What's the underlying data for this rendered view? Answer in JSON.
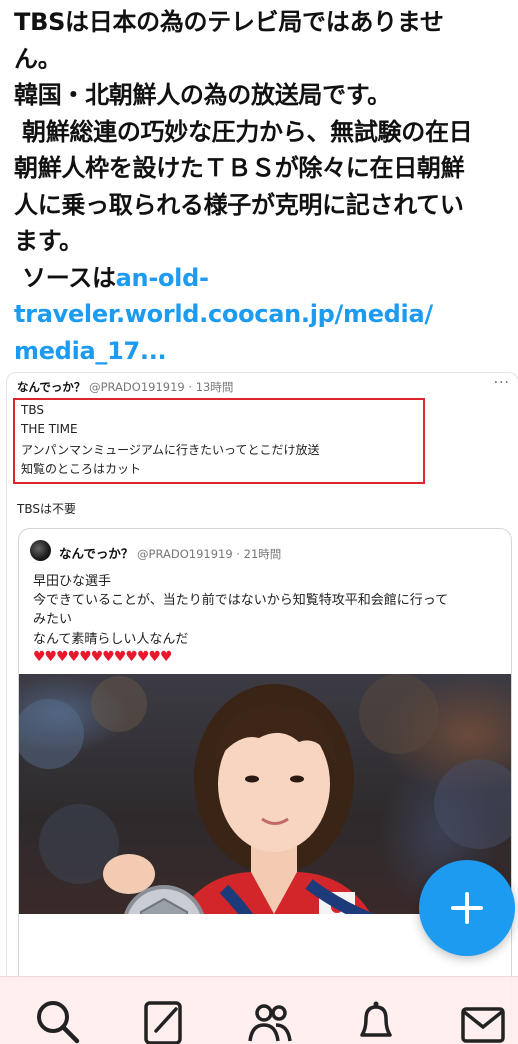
{
  "tweet": {
    "lines": [
      "TBSは日本の為のテレビ局ではありませ",
      "ん。",
      "韓国・北朝鮮人の為の放送局です。",
      " 朝鮮総連の巧妙な圧力から、無試験の在日",
      "朝鮮人枠を設けたＴＢＳが除々に在日朝鮮",
      "人に乗っ取られる様子が克明に記されてい",
      "ます。"
    ],
    "source_label": " ソースは",
    "link_lines": [
      "an-old-",
      "traveler.world.coocan.jp/media/",
      "media_17..."
    ]
  },
  "screenshot": {
    "header": {
      "name": "なんでっか？",
      "handle_time": " @PRADO191919 · 13時間"
    },
    "more_icon": "···",
    "highlighted_lines": [
      "TBS",
      "THE TIME",
      "アンパンマンミュージアムに行きたいってとこだけ放送",
      "知覧のところはカット"
    ],
    "comment": "TBSは不要",
    "quote": {
      "name": "なんでっか？",
      "handle_time": " @PRADO191919 · 21時間",
      "lines": [
        "早田ひな選手",
        "今できていることが、当たり前ではないから知覧特攻平和会館に行って",
        "みたい",
        "なんて素晴らしい人なんだ"
      ],
      "hearts": "♥♥♥♥♥♥♥♥♥♥♥♥"
    }
  },
  "fab_icon": "plus-icon",
  "tabbar": {
    "icons": [
      "search-icon",
      "compose-icon",
      "people-icon",
      "bell-icon",
      "mail-icon"
    ]
  },
  "colors": {
    "link": "#1d9bf0",
    "highlight_border": "#e0242c",
    "hearts": "#e8192c",
    "fab": "#1d9bf0",
    "tabbar_bg": "#ffeeee"
  }
}
